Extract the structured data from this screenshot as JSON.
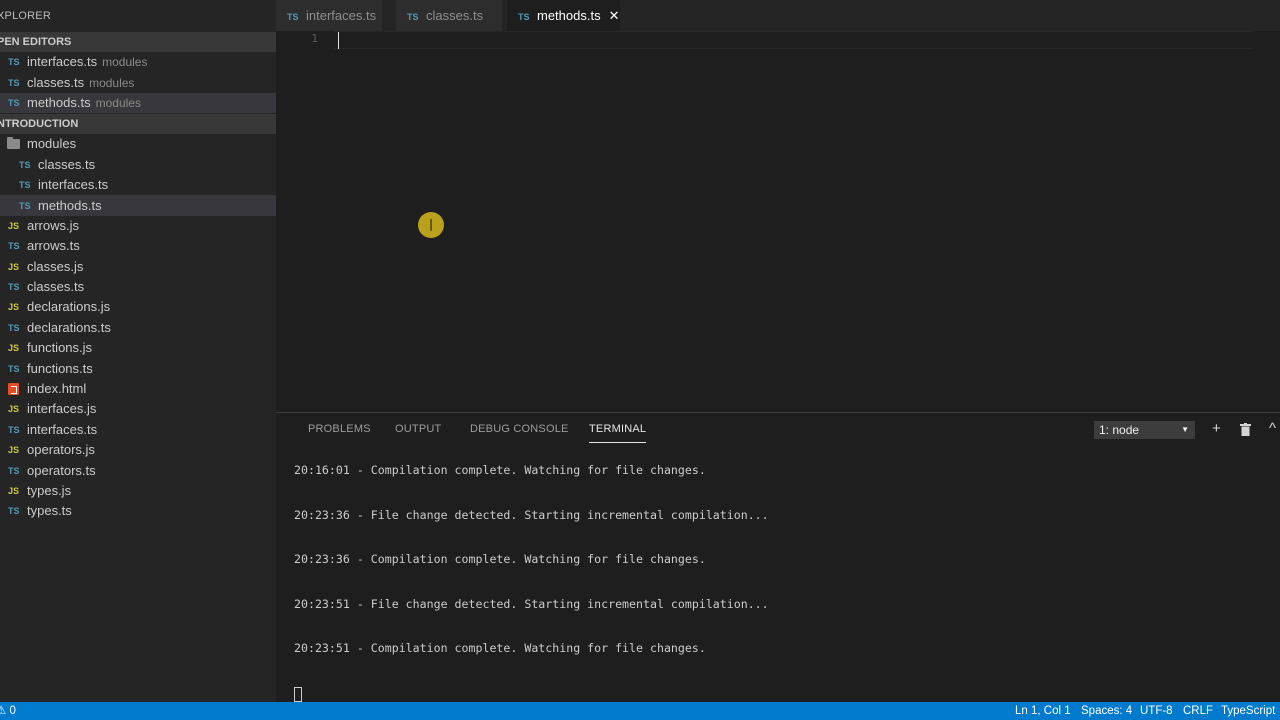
{
  "sidebar": {
    "title": "XPLORER",
    "open_editors_label": "PEN EDITORS",
    "open_editors": [
      {
        "icon": "TS",
        "name": "interfaces.ts",
        "desc": "modules"
      },
      {
        "icon": "TS",
        "name": "classes.ts",
        "desc": "modules"
      },
      {
        "icon": "TS",
        "name": "methods.ts",
        "desc": "modules"
      }
    ],
    "project_label": "NTRODUCTION",
    "folder": {
      "name": "modules"
    },
    "folder_files": [
      {
        "icon": "TS",
        "name": "classes.ts"
      },
      {
        "icon": "TS",
        "name": "interfaces.ts"
      },
      {
        "icon": "TS",
        "name": "methods.ts"
      }
    ],
    "files": [
      {
        "icon": "JS",
        "name": "arrows.js"
      },
      {
        "icon": "TS",
        "name": "arrows.ts"
      },
      {
        "icon": "JS",
        "name": "classes.js"
      },
      {
        "icon": "TS",
        "name": "classes.ts"
      },
      {
        "icon": "JS",
        "name": "declarations.js"
      },
      {
        "icon": "TS",
        "name": "declarations.ts"
      },
      {
        "icon": "JS",
        "name": "functions.js"
      },
      {
        "icon": "TS",
        "name": "functions.ts"
      },
      {
        "icon": "html-file-icon",
        "name": "index.html"
      },
      {
        "icon": "JS",
        "name": "interfaces.js"
      },
      {
        "icon": "TS",
        "name": "interfaces.ts"
      },
      {
        "icon": "JS",
        "name": "operators.js"
      },
      {
        "icon": "TS",
        "name": "operators.ts"
      },
      {
        "icon": "JS",
        "name": "types.js"
      },
      {
        "icon": "TS",
        "name": "types.ts"
      }
    ]
  },
  "tabs": [
    {
      "icon": "TS",
      "label": "interfaces.ts"
    },
    {
      "icon": "TS",
      "label": "classes.ts"
    },
    {
      "icon": "TS",
      "label": "methods.ts",
      "close": "✕"
    }
  ],
  "editor": {
    "line_number": "1"
  },
  "panel": {
    "tabs": [
      "PROBLEMS",
      "OUTPUT",
      "DEBUG CONSOLE",
      "TERMINAL"
    ],
    "active_tab": "TERMINAL",
    "terminal_select": "1: node",
    "terminal_lines": [
      "20:16:01 - Compilation complete. Watching for file changes.",
      "20:23:36 - File change detected. Starting incremental compilation...",
      "20:23:36 - Compilation complete. Watching for file changes.",
      "20:23:51 - File change detected. Starting incremental compilation...",
      "20:23:51 - Compilation complete. Watching for file changes."
    ]
  },
  "statusbar": {
    "left": "⚠ 0",
    "position": "Ln 1, Col 1",
    "spaces": "Spaces: 4",
    "encoding": "UTF-8",
    "eol": "CRLF",
    "language": "TypeScript"
  },
  "colors": {
    "accent": "#007acc",
    "ts_badge": "#519aba",
    "js_badge": "#cbcb41",
    "html_icon": "#e44d26"
  }
}
